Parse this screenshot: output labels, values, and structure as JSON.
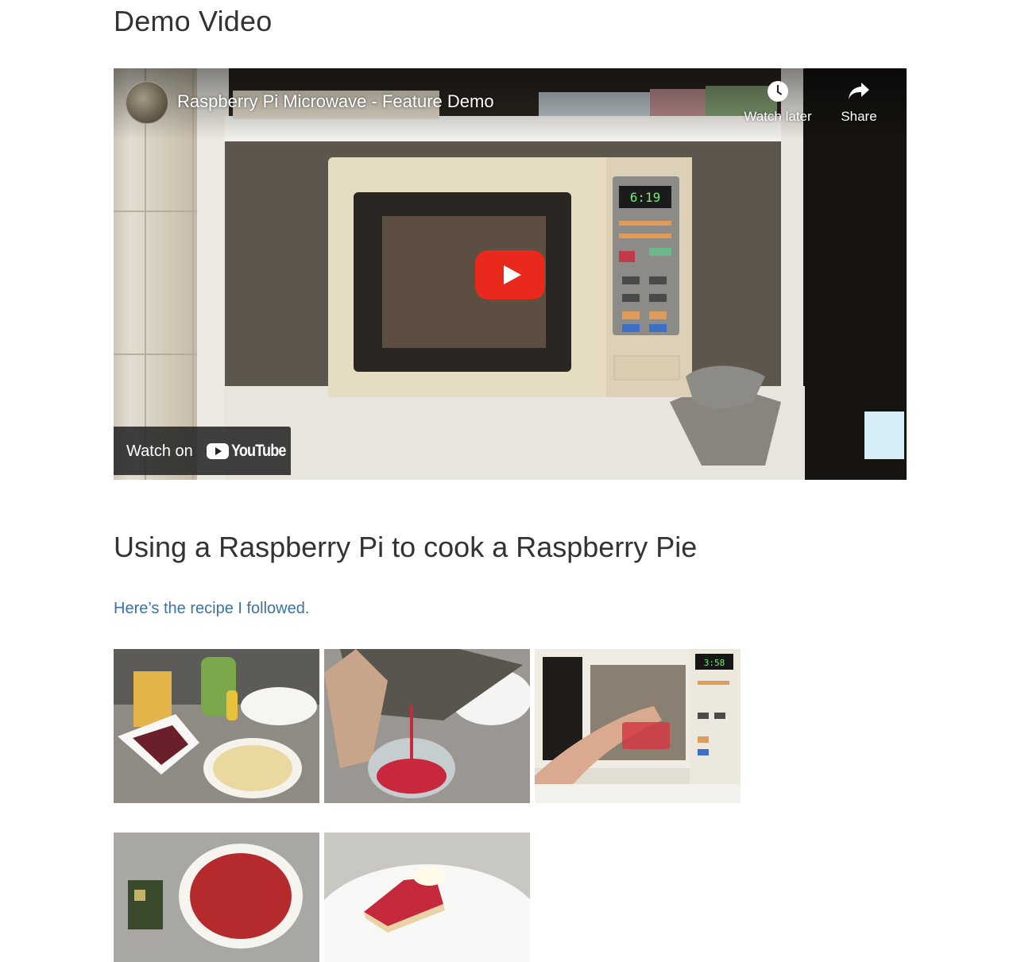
{
  "demo_section": {
    "heading": "Demo Video"
  },
  "video": {
    "title": "Raspberry Pi Microwave - Feature Demo",
    "watch_later_label": "Watch later",
    "share_label": "Share",
    "watch_on_label": "Watch on",
    "youtube_wordmark": "YouTube",
    "microwave_display": "6:19",
    "accent_color": "#e8291c"
  },
  "recipe_section": {
    "heading": "Using a Raspberry Pi to cook a Raspberry Pie",
    "link_text": "Here’s the recipe I followed."
  },
  "gallery": {
    "microwave_display": "3:58",
    "images": [
      {
        "subject": "ingredients-raspberries-pastry-case"
      },
      {
        "subject": "pouring-mixture-into-jug"
      },
      {
        "subject": "jug-into-microwave"
      },
      {
        "subject": "raspberry-pie-with-raspberry-pi-board"
      },
      {
        "subject": "slice-of-pie-with-cream"
      }
    ]
  }
}
